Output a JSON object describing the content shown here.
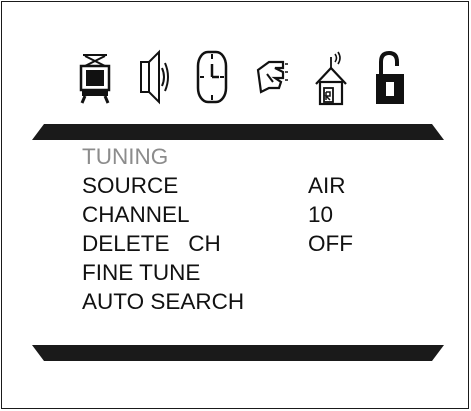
{
  "icons": [
    {
      "name": "tv-picture-icon"
    },
    {
      "name": "speaker-sound-icon"
    },
    {
      "name": "clock-time-icon"
    },
    {
      "name": "hand-function-icon"
    },
    {
      "name": "house-antenna-icon"
    },
    {
      "name": "padlock-unlocked-icon"
    }
  ],
  "menu": {
    "title": "TUNING",
    "items": [
      {
        "label": "SOURCE",
        "value": "AIR"
      },
      {
        "label": "CHANNEL",
        "value": "10"
      },
      {
        "label": "DELETE   CH",
        "value": "OFF"
      },
      {
        "label": "FINE TUNE",
        "value": ""
      },
      {
        "label": "AUTO SEARCH",
        "value": ""
      }
    ]
  },
  "colors": {
    "text": "#111111",
    "title": "#8c8c8c",
    "bar": "#1a1a1a",
    "background": "#ffffff"
  }
}
